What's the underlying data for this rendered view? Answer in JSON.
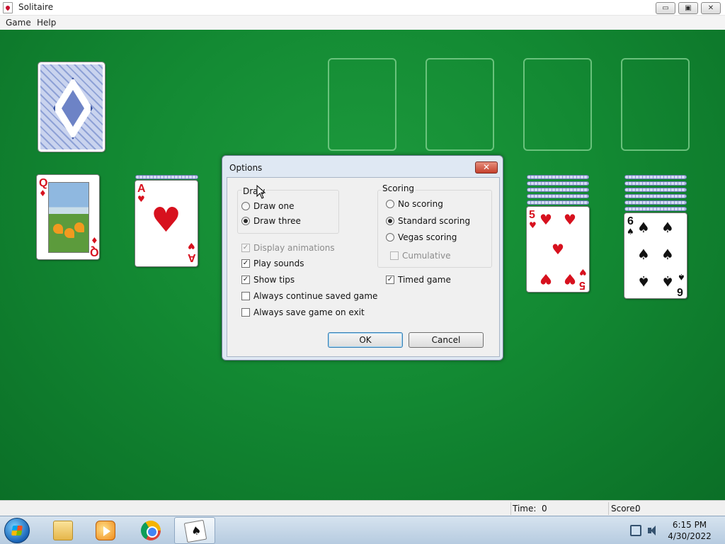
{
  "window": {
    "title": "Solitaire",
    "min": "▭",
    "max": "▣",
    "close": "✕"
  },
  "menu": {
    "game": "Game",
    "help": "Help"
  },
  "cards": {
    "queen": {
      "rank": "Q",
      "suit": "♦"
    },
    "ace": {
      "rank": "A",
      "suit": "♥"
    },
    "five": {
      "rank": "5",
      "suit": "♥"
    },
    "six": {
      "rank": "6",
      "suit": "♠"
    }
  },
  "dialog": {
    "title": "Options",
    "close": "✕",
    "draw": {
      "label": "Draw",
      "options": [
        {
          "label": "Draw one",
          "selected": false
        },
        {
          "label": "Draw three",
          "selected": true
        }
      ]
    },
    "scoring": {
      "label": "Scoring",
      "options": [
        {
          "label": "No scoring",
          "selected": false
        },
        {
          "label": "Standard scoring",
          "selected": true
        },
        {
          "label": "Vegas scoring",
          "selected": false
        }
      ],
      "cumulative": {
        "label": "Cumulative",
        "checked": false,
        "enabled": false
      }
    },
    "checks": [
      {
        "label": "Display animations",
        "checked": true,
        "enabled": false
      },
      {
        "label": "Play sounds",
        "checked": true,
        "enabled": true
      },
      {
        "label": "Show tips",
        "checked": true,
        "enabled": true
      },
      {
        "label": "Always continue saved game",
        "checked": false,
        "enabled": true
      },
      {
        "label": "Always save game on exit",
        "checked": false,
        "enabled": true
      }
    ],
    "timed": {
      "label": "Timed game",
      "checked": true
    },
    "ok": "OK",
    "cancel": "Cancel"
  },
  "status": {
    "time_label": "Time:",
    "time_value": "0",
    "score_label": "Score:",
    "score_value": "0"
  },
  "taskbar": {
    "time": "6:15 PM",
    "date": "4/30/2022"
  }
}
